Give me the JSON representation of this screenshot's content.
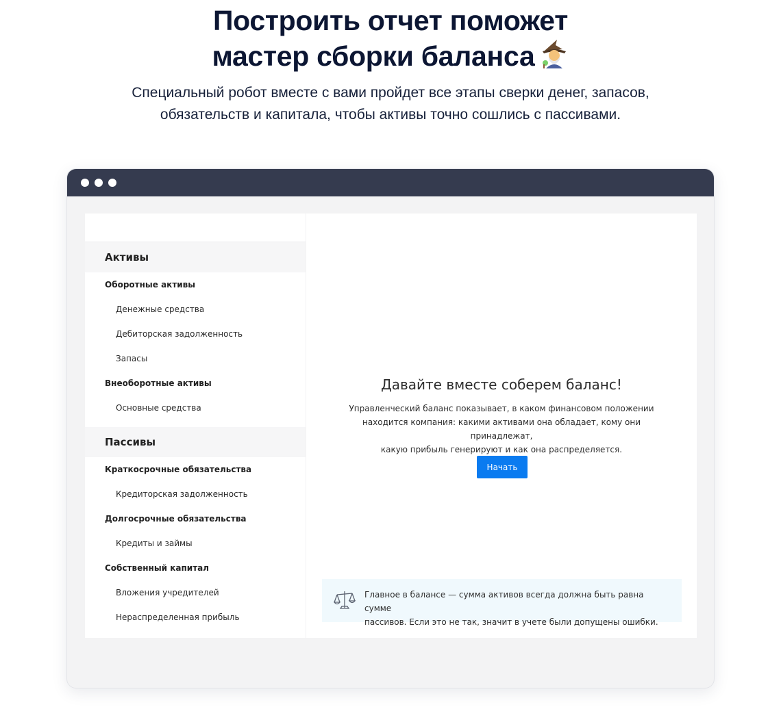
{
  "hero": {
    "title_line1": "Построить отчет поможет",
    "title_line2": "мастер сборки баланса",
    "title_emoji": "wizard-emoji",
    "subtitle_line1": "Специальный робот вместе с вами пройдет все этапы сверки денег, запасов,",
    "subtitle_line2": "обязательств и капитала, чтобы активы точно сошлись с пассивами."
  },
  "window": {
    "titlebar_color": "#353b4f",
    "controls": [
      "window-dot",
      "window-dot",
      "window-dot"
    ]
  },
  "sidebar": {
    "assets": {
      "title": "Активы",
      "current": {
        "label": "Оборотные активы",
        "items": [
          "Денежные средства",
          "Дебиторская задолженность",
          "Запасы"
        ]
      },
      "noncurrent": {
        "label": "Внеоборотные активы",
        "items": [
          "Основные средства"
        ]
      }
    },
    "liabilities": {
      "title": "Пассивы",
      "short_term": {
        "label": "Краткосрочные обязательства",
        "items": [
          "Кредиторская задолженность"
        ]
      },
      "long_term": {
        "label": "Долгосрочные обязательства",
        "items": [
          "Кредиты и займы"
        ]
      },
      "equity": {
        "label": "Собственный капитал",
        "items": [
          "Вложения учредителей",
          "Нераспределенная прибыль"
        ]
      }
    }
  },
  "main": {
    "title": "Давайте вместе соберем баланс!",
    "desc_line1": "Управленческий баланс показывает, в каком финансовом положении",
    "desc_line2": "находится компания: какими активами она обладает, кому они принадлежат,",
    "desc_line3": "какую прибыль генерируют и как она распределяется.",
    "start_button": "Начать",
    "accent_color": "#0a7bf0",
    "note": {
      "icon": "scales-icon",
      "line1": "Главное в балансе — сумма активов всегда должна быть равна сумме",
      "line2": "пассивов. Если это не так, значит в учете были допущены ошибки."
    }
  }
}
